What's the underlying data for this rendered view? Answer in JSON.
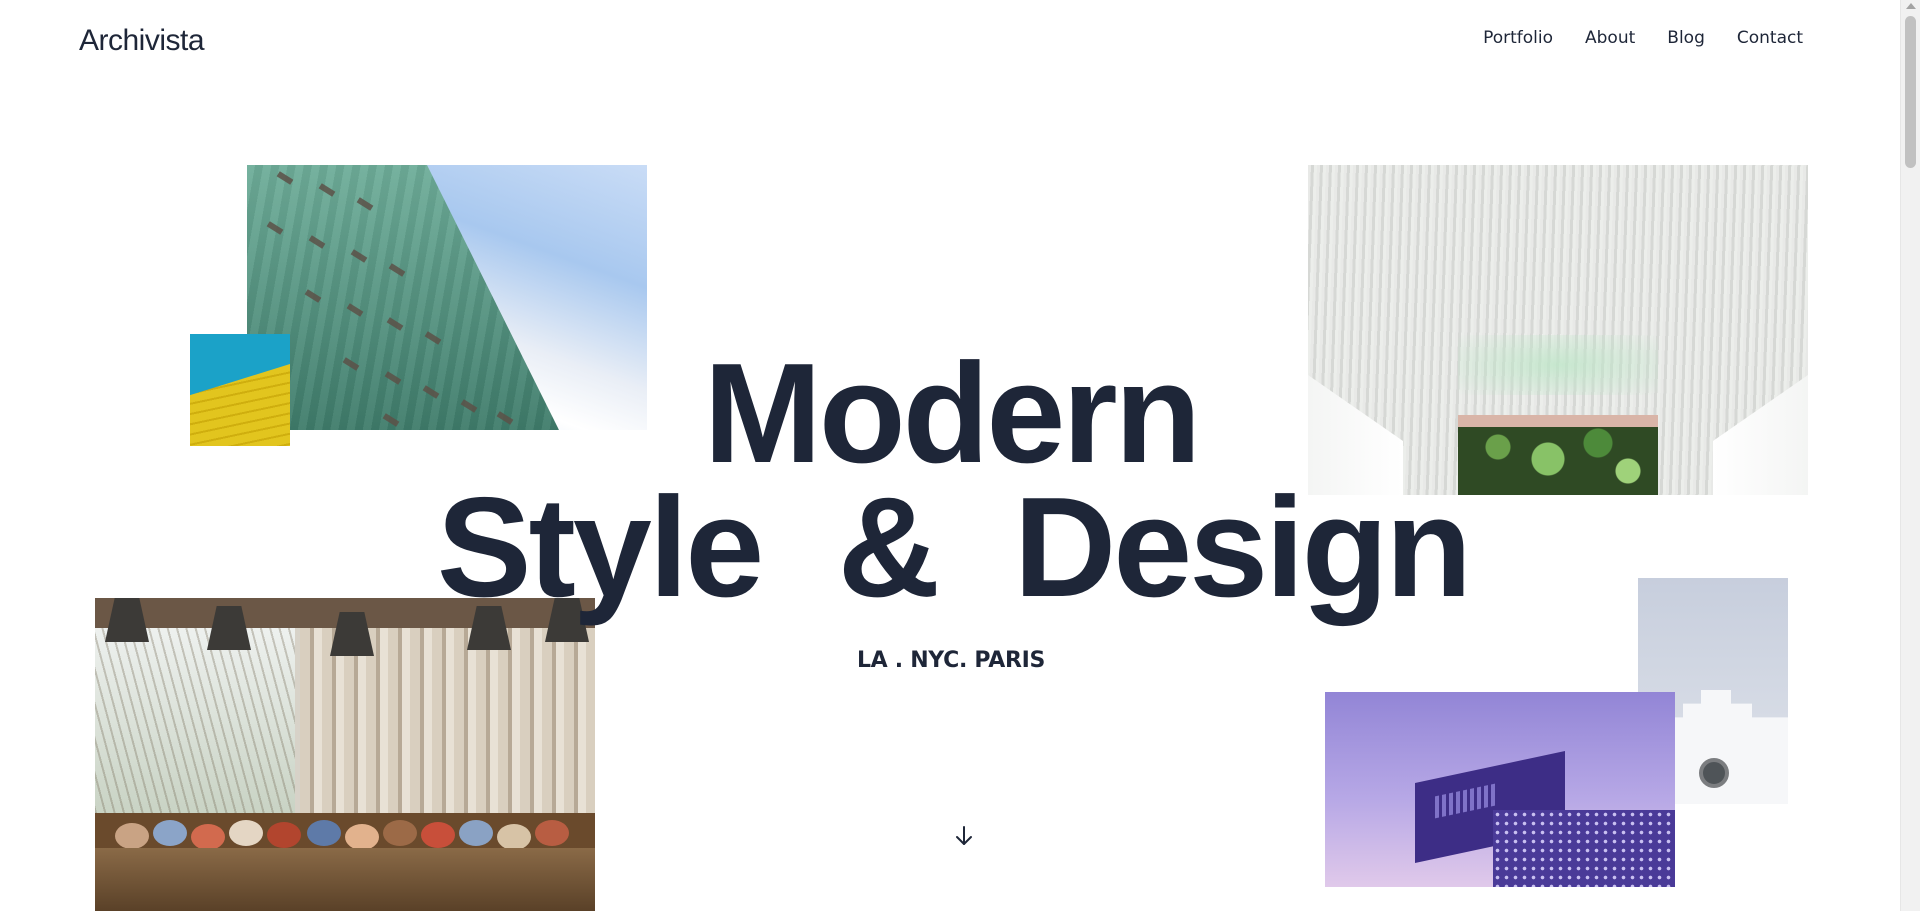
{
  "header": {
    "logo": "Archivista",
    "nav": [
      "Portfolio",
      "About",
      "Blog",
      "Contact"
    ]
  },
  "hero": {
    "line1": "Modern",
    "line2": "Style & Design",
    "locations": "LA . NYC. PARIS"
  },
  "images": [
    {
      "name": "green-tower-photo",
      "icon": "photo"
    },
    {
      "name": "yellow-building-photo",
      "icon": "photo"
    },
    {
      "name": "white-ceiling-interior-photo",
      "icon": "photo"
    },
    {
      "name": "cafe-seating-photo",
      "icon": "photo"
    },
    {
      "name": "white-stepped-wall-photo",
      "icon": "photo"
    },
    {
      "name": "purple-building-photo",
      "icon": "photo"
    }
  ],
  "icons": {
    "scroll_down": "arrow-down-icon"
  },
  "colors": {
    "text": "#1e2638",
    "background": "#ffffff"
  }
}
